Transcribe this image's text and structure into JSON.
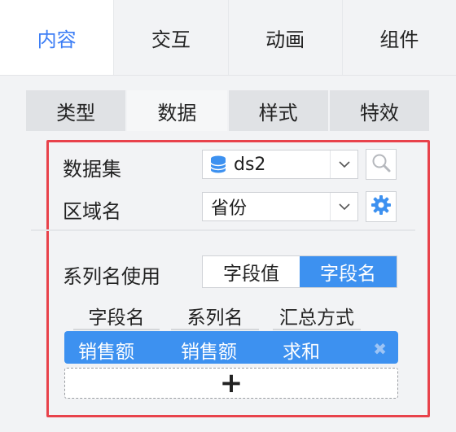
{
  "top_tabs": [
    {
      "label": "内容",
      "active": true
    },
    {
      "label": "交互",
      "active": false
    },
    {
      "label": "动画",
      "active": false
    },
    {
      "label": "组件",
      "active": false
    }
  ],
  "sub_tabs": [
    {
      "label": "类型",
      "active": false
    },
    {
      "label": "数据",
      "active": true
    },
    {
      "label": "样式",
      "active": false
    },
    {
      "label": "特效",
      "active": false
    }
  ],
  "dataset": {
    "label": "数据集",
    "value": "ds2",
    "icon": "database-icon"
  },
  "region": {
    "label": "区域名",
    "value": "省份",
    "icon": "gear-icon"
  },
  "series_name": {
    "label": "系列名使用",
    "options": [
      {
        "label": "字段值",
        "active": false
      },
      {
        "label": "字段名",
        "active": true
      }
    ]
  },
  "field_table": {
    "headers": [
      "字段名",
      "系列名",
      "汇总方式"
    ],
    "rows": [
      {
        "field": "销售额",
        "series": "销售额",
        "summary": "求和"
      }
    ],
    "add_symbol": "+",
    "close_symbol": "✖"
  },
  "colors": {
    "accent": "#3d91f0",
    "active_tab_text": "#3d7ef5",
    "highlight_border": "#e8424b"
  }
}
